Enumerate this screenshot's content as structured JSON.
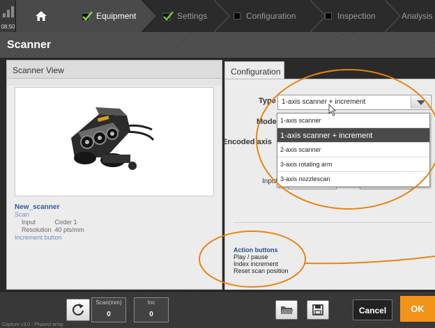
{
  "nav": {
    "time": "08:50",
    "steps": [
      {
        "label": "Equipment",
        "state": "done"
      },
      {
        "label": "Settings",
        "state": "done"
      },
      {
        "label": "Configuration",
        "state": "todo"
      },
      {
        "label": "Inspection",
        "state": "todo"
      },
      {
        "label": "Analysis",
        "state": "todo"
      }
    ]
  },
  "page": {
    "title": "Scanner"
  },
  "left": {
    "header": "Scanner View",
    "scanner_name": "New_scanner",
    "scan_label": "Scan",
    "input_label": "Input",
    "input_value": "Coder 1",
    "resolution_label": "Resolution",
    "resolution_value": "40 pts/mm",
    "increment_label": "Increment button"
  },
  "config": {
    "tab_label": "Configuration",
    "type_label": "Type",
    "mode_label": "Mode",
    "encoded_axis_label": "Encoded axis",
    "input_label": "Input",
    "type_value": "1-axis scanner + increment",
    "options": [
      "1-axis scanner",
      "1-axis scanner + increment",
      "2-axis scanner",
      "3-axis rotating arm",
      "3-axis nozzlescan"
    ],
    "selected_index": 1,
    "action_title": "Action buttons",
    "actions": [
      "Play / pause",
      "Index increment",
      "Reset scan position"
    ]
  },
  "bottom": {
    "scan_label": "Scan(mm)",
    "scan_value": "0",
    "inc_label": "Inc",
    "inc_value": "0",
    "cancel_label": "Cancel",
    "ok_label": "OK",
    "version": "Capture v3.0 - Phased array"
  },
  "colors": {
    "accent": "#f39319",
    "annotation": "#e8830f",
    "link": "#2b5aa6"
  }
}
